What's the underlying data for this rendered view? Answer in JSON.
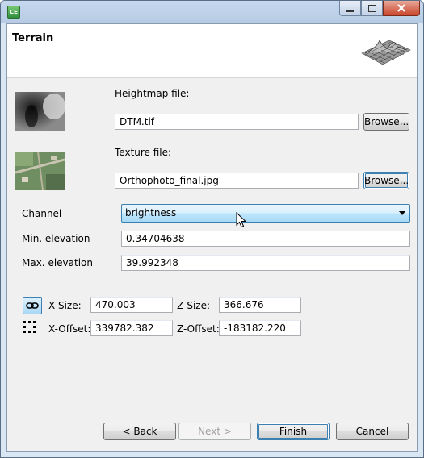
{
  "window": {
    "app_icon_text": "CE",
    "icons": [
      "minimize-icon",
      "maximize-icon",
      "close-icon"
    ]
  },
  "header": {
    "title": "Terrain",
    "icon": "terrain-mesh-icon"
  },
  "heightmap": {
    "label": "Heightmap file:",
    "value": "DTM.tif",
    "browse_label": "Browse..."
  },
  "texture": {
    "label": "Texture file:",
    "value": "Orthophoto_final.jpg",
    "browse_label": "Browse..."
  },
  "channel": {
    "label": "Channel",
    "selected": "brightness"
  },
  "min_elevation": {
    "label": "Min. elevation",
    "value": "0.34704638"
  },
  "max_elevation": {
    "label": "Max. elevation",
    "value": "39.992348"
  },
  "size": {
    "x_label": "X-Size:",
    "x_value": "470.003",
    "z_label": "Z-Size:",
    "z_value": "366.676"
  },
  "offset": {
    "x_label": "X-Offset:",
    "x_value": "339782.382",
    "z_label": "Z-Offset:",
    "z_value": "-183182.220"
  },
  "footer": {
    "back_label": "< Back",
    "next_label": "Next >",
    "finish_label": "Finish",
    "cancel_label": "Cancel"
  },
  "colors": {
    "accent": "#3c7fb1",
    "titlebar": "#c6d8ee",
    "close": "#c8452b"
  }
}
